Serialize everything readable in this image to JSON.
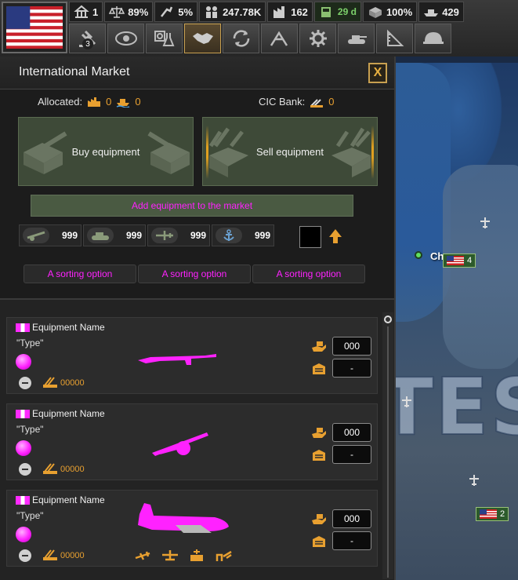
{
  "topbar": {
    "stats": [
      {
        "icon": "political-power-icon",
        "value": "1"
      },
      {
        "icon": "stability-icon",
        "value": "89%"
      },
      {
        "icon": "war-support-icon",
        "value": "5%"
      },
      {
        "icon": "manpower-icon",
        "value": "247.78K"
      },
      {
        "icon": "factories-icon",
        "value": "162"
      },
      {
        "icon": "fuel-icon",
        "value": "29 d"
      },
      {
        "icon": "supply-icon",
        "value": "100%"
      },
      {
        "icon": "convoys-icon",
        "value": "429"
      }
    ],
    "tools": [
      {
        "name": "decisions-tool",
        "badge": "3"
      },
      {
        "name": "intelligence-tool",
        "badge": ""
      },
      {
        "name": "research-tool",
        "badge": ""
      },
      {
        "name": "diplomacy-tool",
        "badge": ""
      },
      {
        "name": "trade-tool",
        "badge": ""
      },
      {
        "name": "construction-tool",
        "badge": ""
      },
      {
        "name": "production-tool",
        "badge": ""
      },
      {
        "name": "logistics-tool",
        "badge": ""
      },
      {
        "name": "recruit-tool",
        "badge": ""
      },
      {
        "name": "army-tool",
        "badge": ""
      }
    ],
    "flag_country": "United States"
  },
  "market": {
    "title": "International Market",
    "close_label": "X",
    "allocated_label": "Allocated:",
    "allocated_civ": "0",
    "allocated_convoy": "0",
    "cic_label": "CIC Bank:",
    "cic_value": "0",
    "buy_label": "Buy equipment",
    "sell_label": "Sell equipment",
    "add_label": "Add equipment to the market",
    "counters": [
      {
        "icon": "artillery-icon",
        "value": "999"
      },
      {
        "icon": "tank-icon",
        "value": "999"
      },
      {
        "icon": "plane-icon",
        "value": "999"
      },
      {
        "icon": "anchor-icon",
        "value": "999"
      }
    ],
    "sort_options": [
      "A sorting option",
      "A sorting option",
      "A sorting option"
    ],
    "items": [
      {
        "name": "Equipment Name",
        "type": "\"Type\"",
        "count": "00000",
        "amount": "000",
        "stock": "-",
        "image": "rifle"
      },
      {
        "name": "Equipment Name",
        "type": "\"Type\"",
        "count": "00000",
        "amount": "000",
        "stock": "-",
        "image": "artillery"
      },
      {
        "name": "Equipment Name",
        "type": "\"Type\"",
        "count": "00000",
        "amount": "000",
        "stock": "-",
        "image": "transport-plane"
      }
    ]
  },
  "map": {
    "city_label": "Ch",
    "units": [
      {
        "value": "4"
      },
      {
        "value": "2"
      }
    ],
    "big_text": "TES"
  },
  "colors": {
    "accent": "#e8a030",
    "placeholder": "#ff22ff",
    "button_green": "#3e4a38"
  }
}
